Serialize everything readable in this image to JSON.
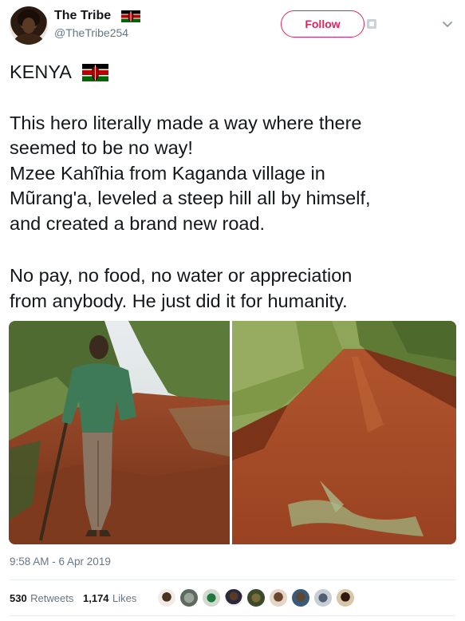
{
  "user": {
    "display_name": "The Tribe",
    "handle": "@TheTribe254",
    "follow_label": "Follow"
  },
  "tweet": {
    "line1": "KENYA",
    "para1_l1": "This hero literally made a way where there",
    "para1_l2": "seemed to be no way!",
    "para1_l3": "Mzee Kahĩhia from Kaganda village in",
    "para1_l4": "Mũrang'a, leveled a steep hill all by himself,",
    "para1_l5": "and created a brand new road.",
    "para2_l1": "No pay, no food, no water or appreciation",
    "para2_l2": "from anybody. He just did it for humanity."
  },
  "meta": {
    "timestamp": "9:58 AM - 6 Apr 2019",
    "retweets_count": "530",
    "retweets_label": "Retweets",
    "likes_count": "1,174",
    "likes_label": "Likes"
  },
  "colors": {
    "follow_accent": "#e0245e",
    "secondary_text": "#657786",
    "primary_text": "#14171a",
    "divider": "#e6ecf0"
  },
  "icons": {
    "name_flag": "kenya-flag-icon",
    "text_flag": "kenya-flag-icon",
    "follow_extra": "follow-options-icon",
    "caret": "chevron-down-icon"
  },
  "images": {
    "left_photo": "man-standing-with-tool-on-red-soil-hillside",
    "right_photo": "newly-cut-red-dirt-road-through-bushes"
  }
}
